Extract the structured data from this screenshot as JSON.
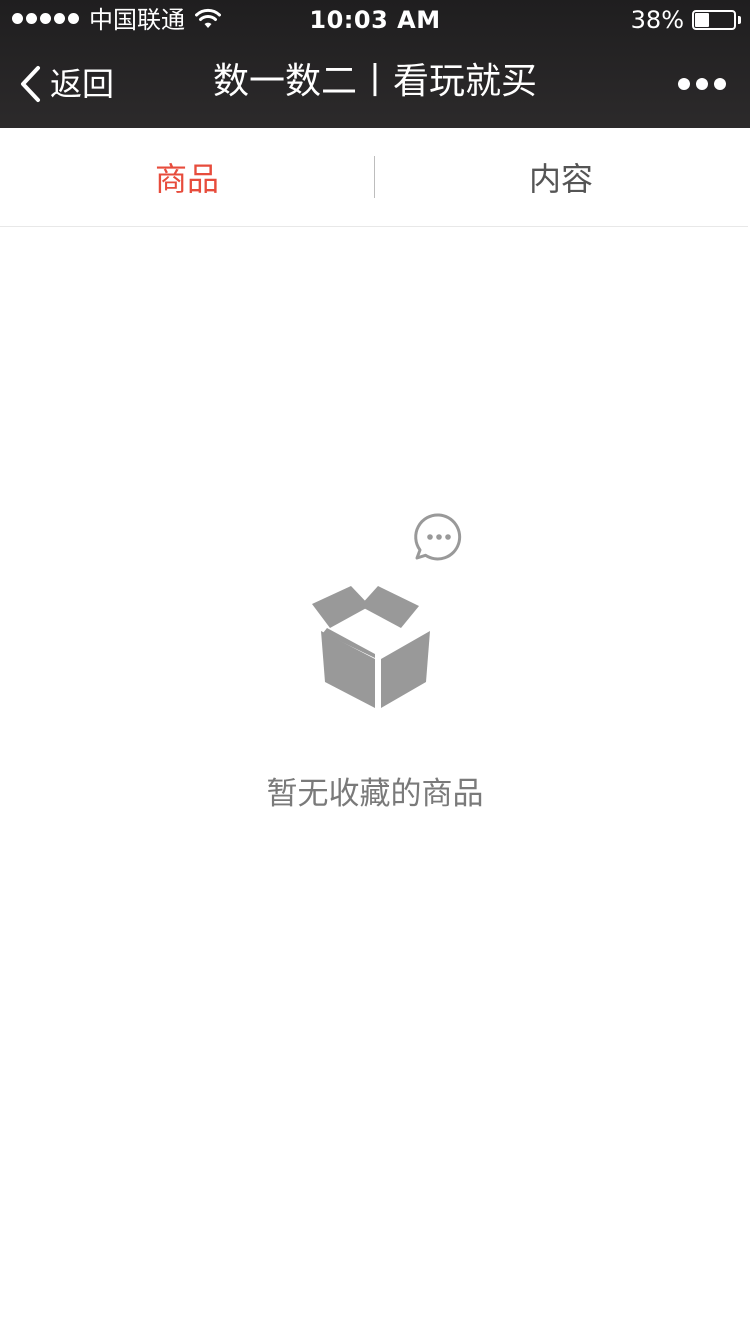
{
  "status_bar": {
    "carrier": "中国联通",
    "time": "10:03 AM",
    "battery_percent_text": "38%",
    "battery_level": 0.38,
    "signal_bars": 5
  },
  "navbar": {
    "back_label": "返回",
    "title": "数一数二丨看玩就买",
    "more_icon": "more-dots-icon"
  },
  "tabs": [
    {
      "label": "商品",
      "active": true
    },
    {
      "label": "内容",
      "active": false
    }
  ],
  "empty_state": {
    "message": "暂无收藏的商品",
    "icons": [
      "chat-bubble-icon",
      "open-box-icon"
    ]
  },
  "colors": {
    "header_background": "#262425",
    "active_tab": "#e74c3c",
    "inactive_tab": "#555555",
    "empty_text": "#7a7a7a",
    "illustration": "#999999"
  }
}
